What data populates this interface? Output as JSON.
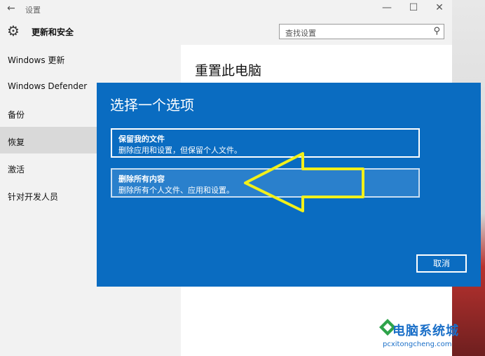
{
  "window": {
    "title": "设置",
    "back_glyph": "←",
    "minimize": "—",
    "maximize": "☐",
    "close": "✕"
  },
  "header": {
    "section_title": "更新和安全",
    "search_placeholder": "查找设置"
  },
  "sidebar": {
    "items": [
      {
        "label": "Windows 更新"
      },
      {
        "label": "Windows Defender"
      },
      {
        "label": "备份"
      },
      {
        "label": "恢复",
        "active": true
      },
      {
        "label": "激活"
      },
      {
        "label": "针对开发人员"
      }
    ]
  },
  "content": {
    "heading": "重置此电脑"
  },
  "dialog": {
    "title": "选择一个选项",
    "options": [
      {
        "title": "保留我的文件",
        "desc": "删除应用和设置，但保留个人文件。"
      },
      {
        "title": "删除所有内容",
        "desc": "删除所有个人文件、应用和设置。"
      }
    ],
    "cancel_label": "取消"
  },
  "watermark": {
    "text": "电脑系统城",
    "url": "pcxitongcheng.com"
  },
  "colors": {
    "dialog_bg": "#0a6cc1",
    "arrow": "#f2f01a",
    "accent": "#1a6fc8"
  }
}
